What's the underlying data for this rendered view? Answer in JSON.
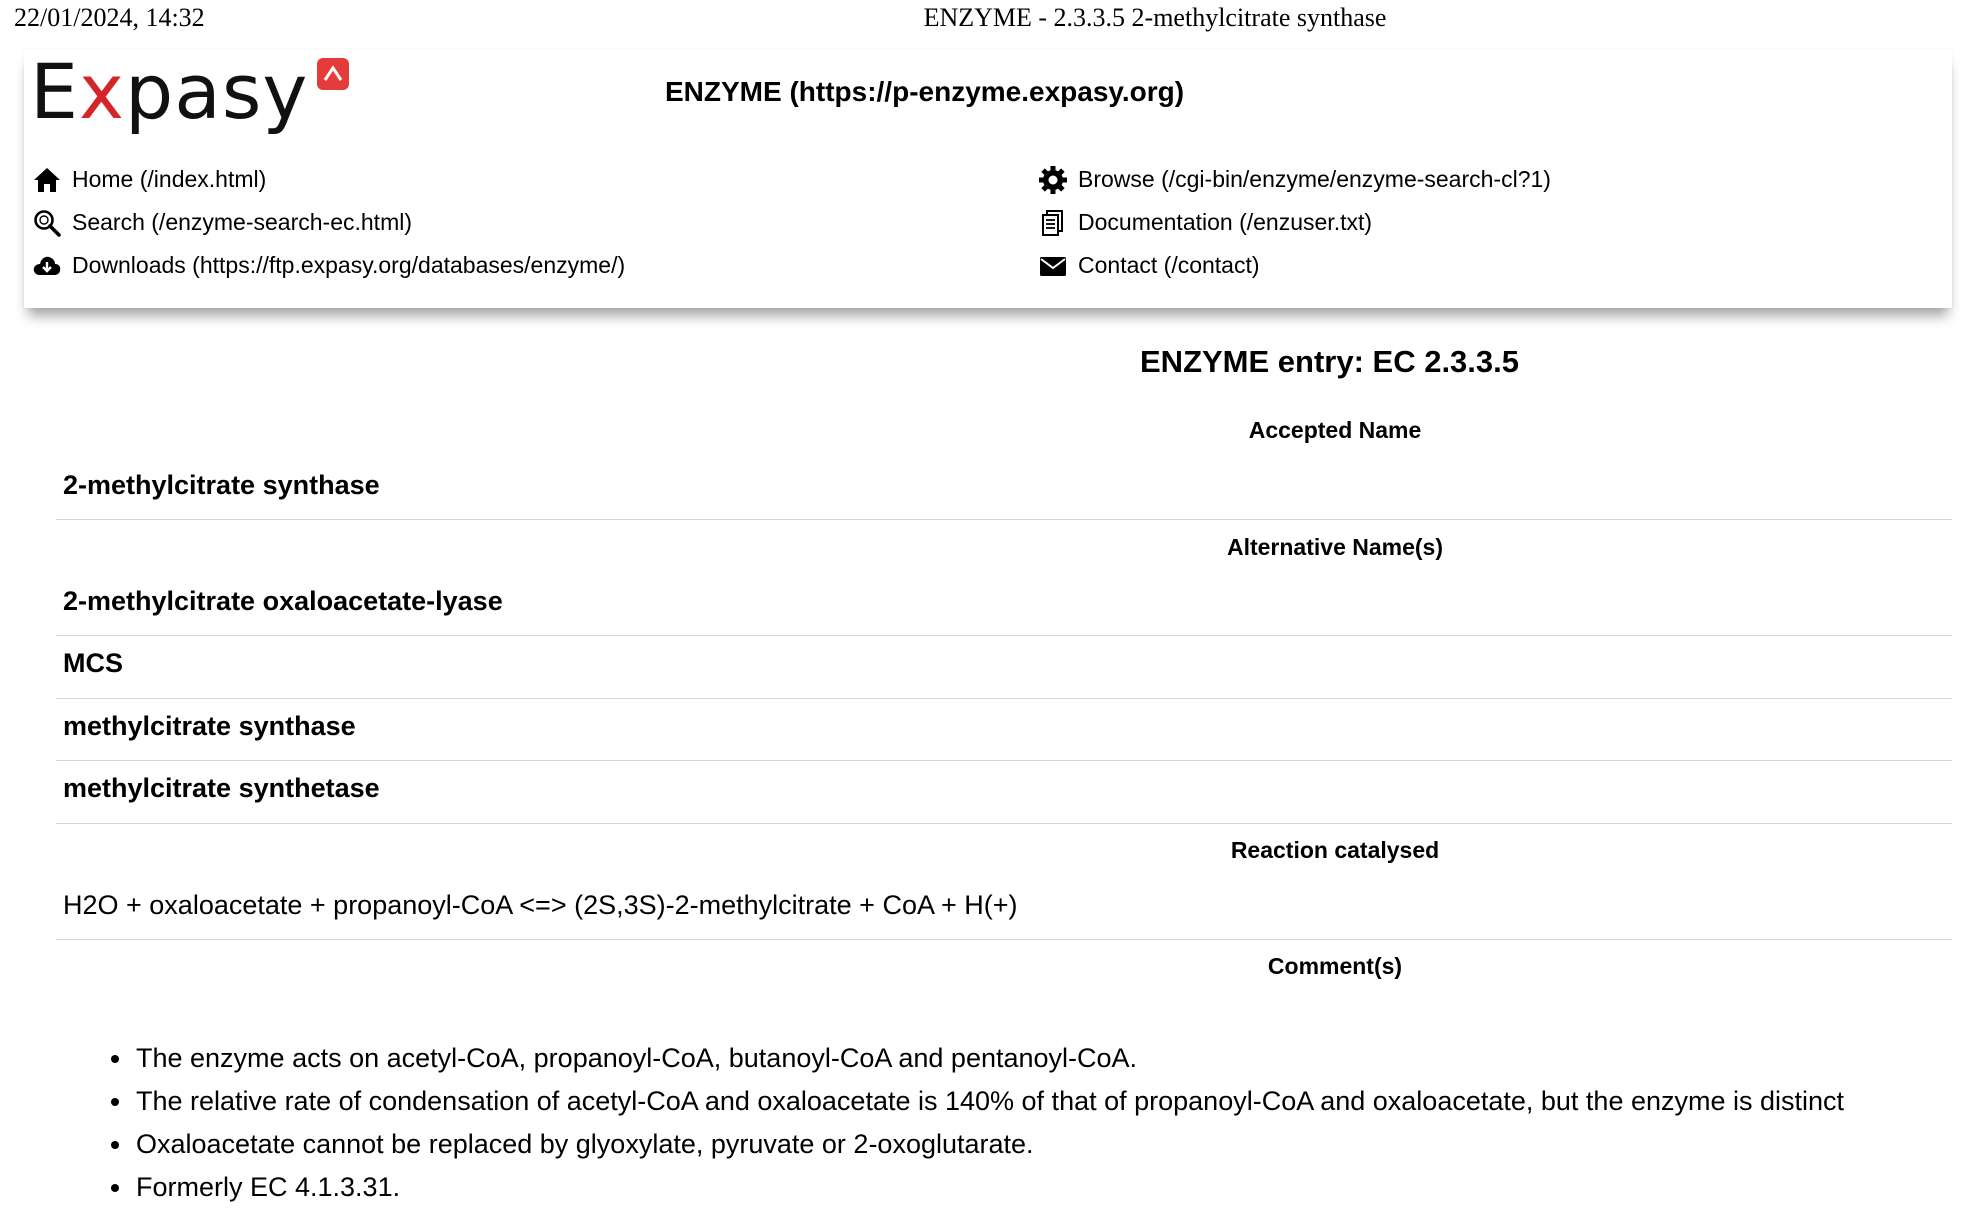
{
  "print_header": {
    "date": "22/01/2024, 14:32",
    "page_title": "ENZYME - 2.3.3.5 2-methylcitrate synthase"
  },
  "header": {
    "logo_text_start": "E",
    "logo_text_x": "x",
    "logo_text_end": "pasy",
    "site_title": "ENZYME (https://p-enzyme.expasy.org)",
    "nav_left": [
      {
        "label": "Home (/index.html)",
        "icon": "home-icon"
      },
      {
        "label": "Search (/enzyme-search-ec.html)",
        "icon": "search-icon"
      },
      {
        "label": "Downloads (https://ftp.expasy.org/databases/enzyme/)",
        "icon": "cloud-download-icon"
      }
    ],
    "nav_right": [
      {
        "label": "Browse (/cgi-bin/enzyme/enzyme-search-cl?1)",
        "icon": "gear-icon"
      },
      {
        "label": "Documentation (/enzuser.txt)",
        "icon": "document-icon"
      },
      {
        "label": "Contact (/contact)",
        "icon": "mail-icon"
      }
    ]
  },
  "entry": {
    "title": "ENZYME entry: EC 2.3.3.5",
    "accepted_name_heading": "Accepted Name",
    "accepted_name": "2-methylcitrate synthase",
    "alternative_names_heading": "Alternative Name(s)",
    "alternative_names": [
      "2-methylcitrate oxaloacetate-lyase",
      "MCS",
      "methylcitrate synthase",
      "methylcitrate synthetase"
    ],
    "reaction_heading": "Reaction catalysed",
    "reaction": "H2O + oxaloacetate + propanoyl-CoA <=> (2S,3S)-2-methylcitrate + CoA + H(+)",
    "comments_heading": "Comment(s)",
    "comments": [
      "The enzyme acts on acetyl-CoA, propanoyl-CoA, butanoyl-CoA and pentanoyl-CoA.",
      "The relative rate of condensation of acetyl-CoA and oxaloacetate is 140% of that of propanoyl-CoA and oxaloacetate, but the enzyme is distinct",
      "Oxaloacetate cannot be replaced by glyoxylate, pyruvate or 2-oxoglutarate.",
      "Formerly EC 4.1.3.31."
    ]
  }
}
